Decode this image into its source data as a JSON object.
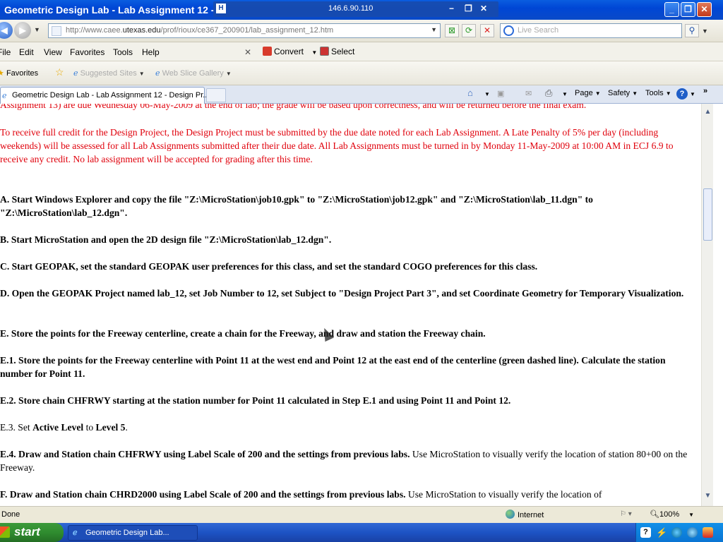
{
  "window": {
    "title": "Geometric Design Lab - Lab Assignment 12 - Design Project Part 3 - Windows Internet Explorer",
    "title_visible": "Geometric Design Lab - Lab Assignment 12 -",
    "remote_ip": "146.6.90.110"
  },
  "address_bar": {
    "url_prefix": "http://www.caee.",
    "url_domain": "utexas.edu",
    "url_suffix": "/prof/rioux/ce367_200901/lab_assignment_12.htm",
    "search_placeholder": "Live Search"
  },
  "menu": {
    "items": [
      "File",
      "Edit",
      "View",
      "Favorites",
      "Tools",
      "Help"
    ],
    "convert_label": "Convert",
    "select_label": "Select"
  },
  "favorites_bar": {
    "favorites_label": "Favorites",
    "suggested_sites": "Suggested Sites",
    "web_slice_gallery": "Web Slice Gallery"
  },
  "tabs": {
    "active_tab": "Geometric Design Lab - Lab Assignment 12 - Design Pr...",
    "page_label": "Page",
    "safety_label": "Safety",
    "tools_label": "Tools"
  },
  "content": {
    "partial_top": "Assignment 13) are due Wednesday 06-May-2009 at the end of lab; the grade will be based upon correctness, and will be returned before the final exam.",
    "late_policy": "To receive full credit for the Design Project, the Design Project must be submitted by the due date noted for each Lab Assignment.  A Late Penalty of 5% per day (including weekends) will be assessed for all Lab Assignments submitted after their due date.  All Lab Assignments must be turned in by Monday 11-May-2009 at 10:00 AM in ECJ 6.9 to receive any credit.  No lab assignment will be accepted for grading after this time.",
    "step_a": "A.   Start Windows Explorer and copy the file \"Z:\\MicroStation\\job10.gpk\" to \"Z:\\MicroStation\\job12.gpk\" and \"Z:\\MicroStation\\lab_11.dgn\" to \"Z:\\MicroStation\\lab_12.dgn\".",
    "step_b": "B.   Start MicroStation and open the 2D design file \"Z:\\MicroStation\\lab_12.dgn\".",
    "step_c": "C.   Start GEOPAK, set the standard GEOPAK user preferences for this class, and set the standard COGO preferences for this class.",
    "step_d": "D.   Open the GEOPAK Project named lab_12, set Job Number to 12, set Subject to \"Design Project Part 3\", and set Coordinate Geometry for Temporary Visualization.",
    "step_e": "E.   Store the points for the Freeway centerline, create a chain for the Freeway, and draw and station the Freeway chain.",
    "step_e1": "E.1.   Store the points for the Freeway centerline with Point 11 at the west end and Point 12 at the east end of the centerline (green dashed line). Calculate the station number for Point 11.",
    "step_e2": "E.2.   Store chain CHFRWY starting at the station number for Point 11 calculated in Step E.1 and using Point 11 and Point 12.",
    "step_e3_prefix": "E.3.   Set ",
    "step_e3_bold1": "Active Level",
    "step_e3_mid": " to ",
    "step_e3_bold2": "Level 5",
    "step_e3_end": ".",
    "step_e4_bold": "E.4.   Draw and Station chain CHFRWY using Label Scale of 200 and the settings from previous labs.",
    "step_e4_rest": "   Use MicroStation to visually verify the location of station 80+00 on the Freeway.",
    "step_f_bold": "F.   Draw and Station chain CHRD2000 using Label Scale of 200 and the settings from previous labs.",
    "step_f_rest": "   Use MicroStation to visually verify the location of"
  },
  "status_bar": {
    "left_text": "Done",
    "zone": "Internet",
    "zoom": "100%"
  },
  "taskbar": {
    "start_label": "start",
    "task_label": "Geometric Design Lab..."
  },
  "colors": {
    "red_text": "#e0000b",
    "titlebar": "#0a5de0",
    "taskbar": "#1d53c4",
    "start": "#2f8c2f"
  }
}
